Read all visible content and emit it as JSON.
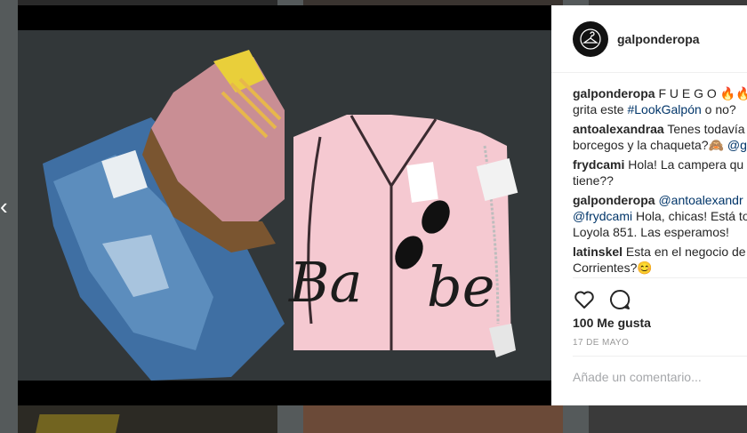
{
  "post": {
    "username": "galponderopa",
    "likes": "100 Me gusta",
    "date": "17 DE MAYO",
    "comment_placeholder": "Añade un comentario..."
  },
  "comments": [
    {
      "user": "galponderopa",
      "parts": [
        "F U E G O 🔥🔥",
        "grita este ",
        "#LookGalpón",
        " o no?"
      ]
    },
    {
      "user": "antoalexandraa",
      "parts": [
        "Tenes todavía",
        "borcegos y la chaqueta?🙈 ",
        "@g"
      ]
    },
    {
      "user": "frydcami",
      "parts": [
        "Hola! La campera qu",
        "tiene??"
      ]
    },
    {
      "user": "galponderopa",
      "parts": [
        "@antoalexandr",
        "@frydcami",
        " Hola, chicas! Está to",
        "Loyola 851. Las esperamos!"
      ]
    },
    {
      "user": "latinskel",
      "parts": [
        "Esta en el negocio de",
        "Corrientes?😊"
      ]
    }
  ],
  "photo": {
    "shirt_text_left": "Ba",
    "shirt_text_right": "be"
  },
  "icons": {
    "avatar": "hanger-icon",
    "like": "heart-icon",
    "comment": "comment-bubble-icon",
    "prev": "chevron-left-icon"
  },
  "colors": {
    "panel_bg": "#ffffff",
    "text": "#262626",
    "link": "#003569",
    "muted": "#999999"
  }
}
